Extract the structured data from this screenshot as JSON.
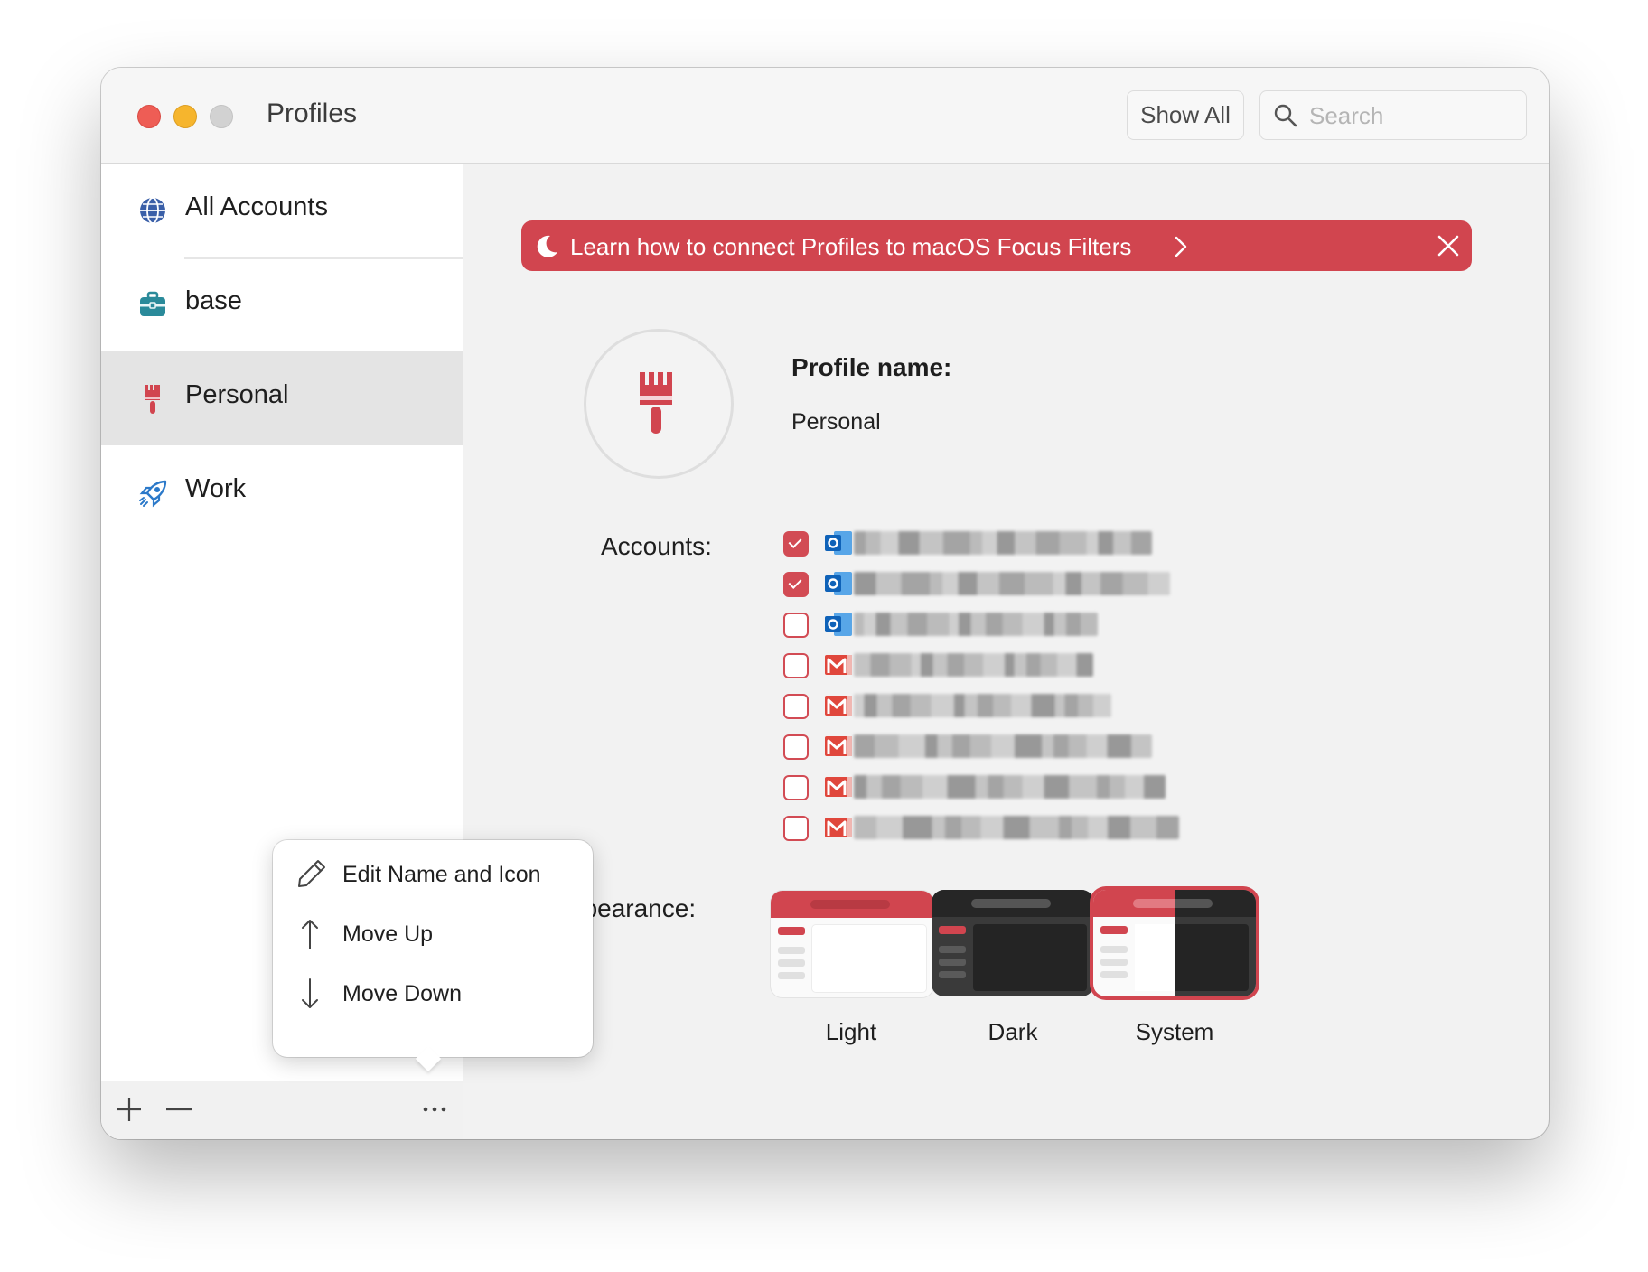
{
  "window": {
    "title": "Profiles",
    "show_all_label": "Show All",
    "search_placeholder": "Search"
  },
  "sidebar": {
    "items": [
      {
        "label": "All Accounts",
        "icon": "globe-icon"
      },
      {
        "label": "base",
        "icon": "briefcase-icon"
      },
      {
        "label": "Personal",
        "icon": "paintbrush-icon",
        "selected": true
      },
      {
        "label": "Work",
        "icon": "rocket-icon"
      }
    ],
    "bottom_buttons": [
      "add-icon",
      "remove-icon",
      "more-icon"
    ]
  },
  "menu": {
    "items": [
      {
        "label": "Edit Name and Icon",
        "icon": "pencil-icon"
      },
      {
        "label": "Move Up",
        "icon": "arrow-up-icon"
      },
      {
        "label": "Move Down",
        "icon": "arrow-down-icon"
      }
    ]
  },
  "banner": {
    "text": "Learn how to connect Profiles to macOS Focus Filters",
    "color": "#d1454f"
  },
  "profile": {
    "name_label": "Profile name:",
    "name_value": "Personal",
    "icon": "paintbrush-icon"
  },
  "accounts": {
    "label": "Accounts:",
    "items": [
      {
        "type": "outlook",
        "checked": true
      },
      {
        "type": "outlook",
        "checked": true
      },
      {
        "type": "outlook",
        "checked": false
      },
      {
        "type": "gmail",
        "checked": false
      },
      {
        "type": "gmail",
        "checked": false
      },
      {
        "type": "gmail",
        "checked": false
      },
      {
        "type": "gmail",
        "checked": false
      },
      {
        "type": "gmail",
        "checked": false
      }
    ]
  },
  "appearance": {
    "label": "ppearance:",
    "options": [
      {
        "label": "Light"
      },
      {
        "label": "Dark"
      },
      {
        "label": "System",
        "selected": true
      }
    ]
  },
  "colors": {
    "accent": "#d1454f",
    "selected_bg": "#e4e4e4"
  }
}
